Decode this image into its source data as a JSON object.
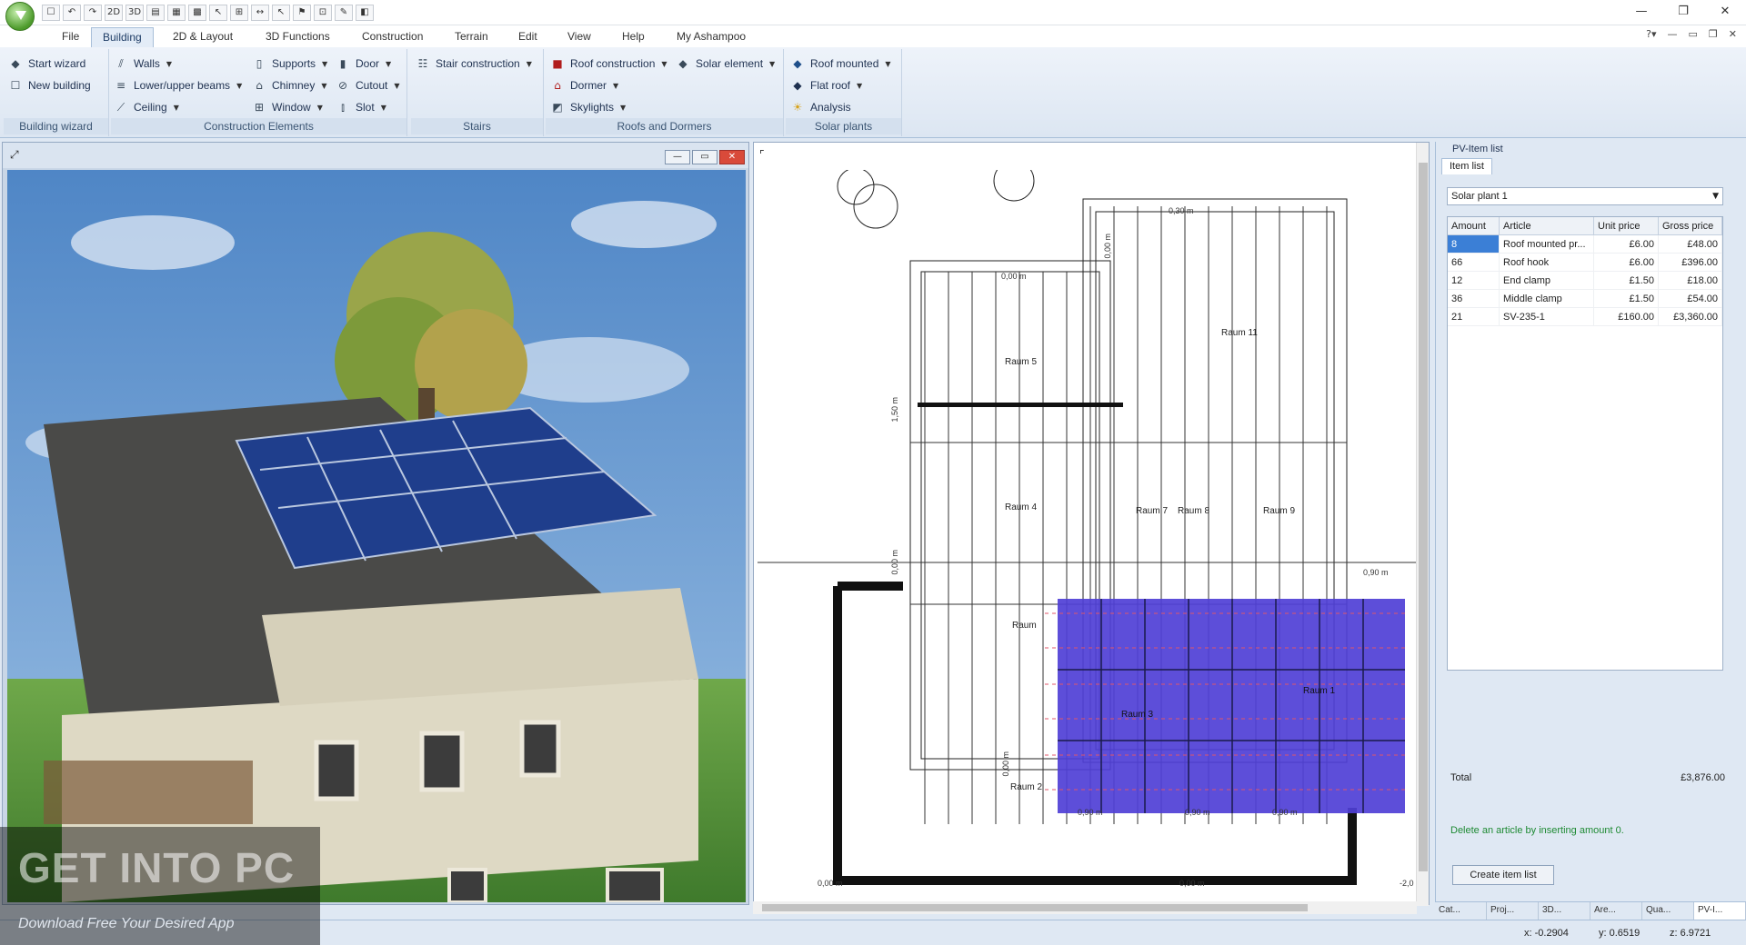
{
  "quick_access": {
    "buttons": [
      "☐",
      "↶",
      "↷",
      "2D",
      "3D",
      "▤",
      "▦",
      "▩",
      "↖",
      "⊞",
      "↔",
      "↖",
      "⚑",
      "⊡",
      "✎",
      "◧"
    ]
  },
  "window_controls": {
    "minimize": "—",
    "restore": "❐",
    "close": "✕"
  },
  "tabs": [
    "File",
    "Building",
    "2D & Layout",
    "3D Functions",
    "Construction",
    "Terrain",
    "Edit",
    "View",
    "Help",
    "My Ashampoo"
  ],
  "active_tab": "Building",
  "help_controls": [
    "?▾",
    "—",
    "▭",
    "❐",
    "✕"
  ],
  "ribbon": {
    "groups": [
      {
        "label": "Building wizard",
        "items": [
          "Start wizard",
          "New building"
        ]
      },
      {
        "label": "Construction Elements",
        "items": [
          "Walls",
          "Lower/upper beams",
          "Ceiling",
          "Supports",
          "Chimney",
          "Window",
          "Door",
          "Cutout",
          "Slot"
        ]
      },
      {
        "label": "Stairs",
        "items": [
          "Stair construction"
        ]
      },
      {
        "label": "Roofs and Dormers",
        "items": [
          "Roof construction",
          "Dormer",
          "Skylights",
          "Solar element"
        ]
      },
      {
        "label": "Solar plants",
        "items": [
          "Roof mounted",
          "Flat roof",
          "Analysis"
        ]
      }
    ]
  },
  "panel_controls": {
    "min": "—",
    "max": "▭",
    "close": "✕"
  },
  "plan": {
    "rooms": [
      "Raum 5",
      "Raum 11",
      "Raum 4",
      "Raum 7",
      "Raum 8",
      "Raum 9",
      "Raum 3",
      "Raum 1",
      "Raum 2",
      "Raum"
    ],
    "dimensions": [
      "0,30 m",
      "0,00 m",
      "0,00 m",
      "1,50 m",
      "0,90 m",
      "0,90 m",
      "0,90 m",
      "0,90 m",
      "0,00 m",
      "0,00 m",
      "0,00 m",
      "0,00 m",
      "-2,0"
    ]
  },
  "pv_panel": {
    "title": "PV-Item list",
    "tab": "Item list",
    "plant_select": "Solar plant 1",
    "columns": [
      "Amount",
      "Article",
      "Unit price",
      "Gross price"
    ],
    "rows": [
      {
        "amount": "8",
        "article": "Roof mounted pr...",
        "unit": "£6.00",
        "gross": "£48.00"
      },
      {
        "amount": "66",
        "article": "Roof hook",
        "unit": "£6.00",
        "gross": "£396.00"
      },
      {
        "amount": "12",
        "article": "End clamp",
        "unit": "£1.50",
        "gross": "£18.00"
      },
      {
        "amount": "36",
        "article": "Middle clamp",
        "unit": "£1.50",
        "gross": "£54.00"
      },
      {
        "amount": "21",
        "article": "SV-235-1",
        "unit": "£160.00",
        "gross": "£3,360.00"
      }
    ],
    "total_label": "Total",
    "total_value": "£3,876.00",
    "hint": "Delete an article by inserting amount 0.",
    "create_button": "Create item list"
  },
  "bottom_tabs": [
    "Cat...",
    "Proj...",
    "3D...",
    "Are...",
    "Qua...",
    "PV-I..."
  ],
  "status": {
    "x": "x: -0.2904",
    "y": "y: 0.6519",
    "z": "z: 6.9721"
  },
  "watermark": {
    "main": "GET INTO PC",
    "sub": "Download Free Your Desired App"
  }
}
